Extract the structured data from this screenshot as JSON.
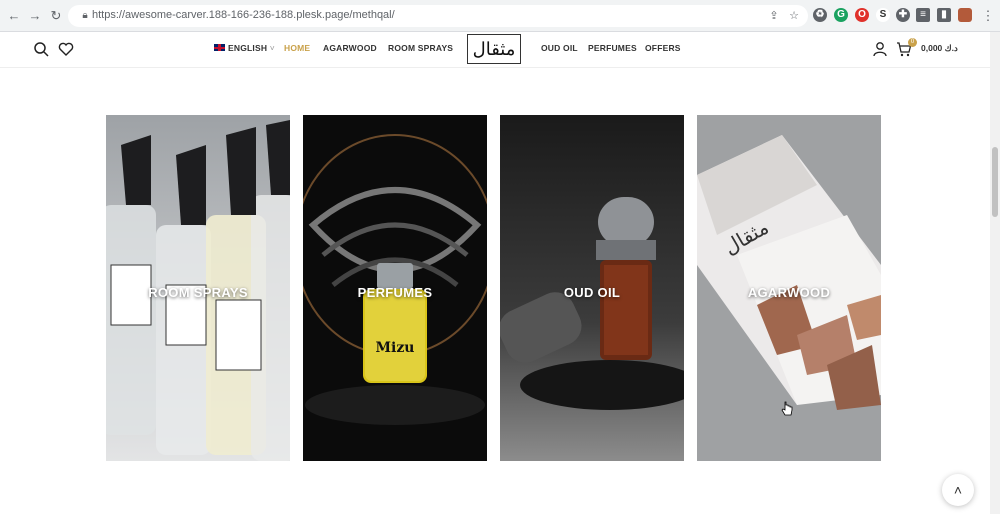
{
  "browser": {
    "url": "https://awesome-carver.188-166-236-188.plesk.page/methqal/"
  },
  "header": {
    "language": "ENGLISH",
    "nav_left": [
      "HOME",
      "AGARWOOD",
      "ROOM SPRAYS"
    ],
    "logo_text": "مثقال",
    "nav_right": [
      "OUD OIL",
      "PERFUMES",
      "OFFERS"
    ],
    "cart_count": "0",
    "cart_amount": "0,000 د.ك",
    "active_color": "#c9a14a"
  },
  "categories": [
    {
      "label": "ROOM SPRAYS"
    },
    {
      "label": "PERFUMES"
    },
    {
      "label": "OUD OIL"
    },
    {
      "label": "AGARWOOD"
    }
  ],
  "icons": {
    "back": "arrow-left-icon",
    "forward": "arrow-right-icon",
    "reload": "reload-icon",
    "search": "search-icon",
    "wishlist": "heart-icon",
    "account": "user-icon",
    "cart": "cart-icon",
    "to_top": "chevron-up-icon"
  }
}
